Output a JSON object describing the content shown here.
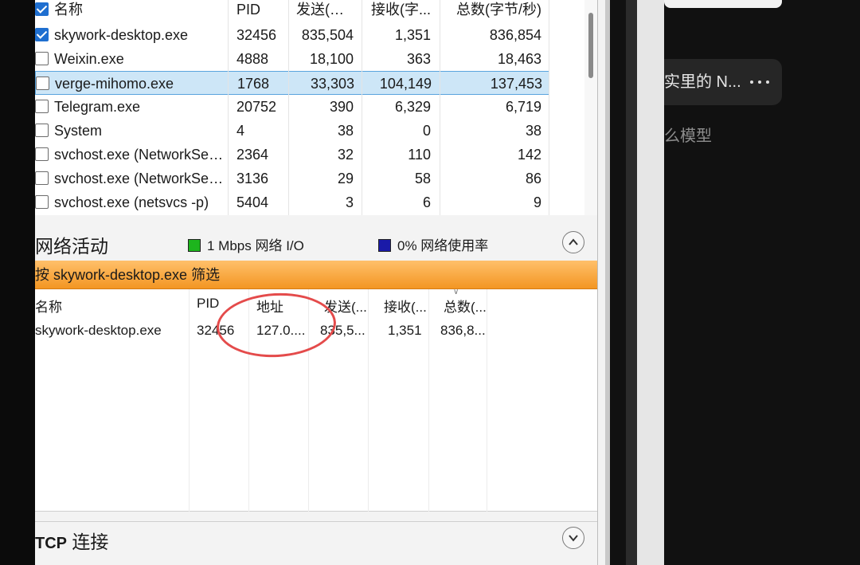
{
  "process_table": {
    "headers": [
      "名称",
      "PID",
      "发送(字...",
      "接收(字...",
      "总数(字节/秒)"
    ],
    "rows": [
      {
        "checked": true,
        "name": "skywork-desktop.exe",
        "pid": "32456",
        "send": "835,504",
        "recv": "1,351",
        "total": "836,854"
      },
      {
        "checked": false,
        "name": "Weixin.exe",
        "pid": "4888",
        "send": "18,100",
        "recv": "363",
        "total": "18,463"
      },
      {
        "checked": false,
        "name": "verge-mihomo.exe",
        "pid": "1768",
        "send": "33,303",
        "recv": "104,149",
        "total": "137,453",
        "selected": true
      },
      {
        "checked": false,
        "name": "Telegram.exe",
        "pid": "20752",
        "send": "390",
        "recv": "6,329",
        "total": "6,719"
      },
      {
        "checked": false,
        "name": "System",
        "pid": "4",
        "send": "38",
        "recv": "0",
        "total": "38"
      },
      {
        "checked": false,
        "name": "svchost.exe (NetworkServi...",
        "pid": "2364",
        "send": "32",
        "recv": "110",
        "total": "142"
      },
      {
        "checked": false,
        "name": "svchost.exe (NetworkServi...",
        "pid": "3136",
        "send": "29",
        "recv": "58",
        "total": "86"
      },
      {
        "checked": false,
        "name": "svchost.exe (netsvcs -p)",
        "pid": "5404",
        "send": "3",
        "recv": "6",
        "total": "9"
      }
    ]
  },
  "network_activity": {
    "title": "网络活动",
    "legend_io": "1 Mbps 网络 I/O",
    "legend_usage": "0% 网络使用率",
    "io_color": "#1db51d",
    "usage_color": "#1a1aa8",
    "filter_label": "按 skywork-desktop.exe 筛选",
    "filter_color": "#f7a53a",
    "headers": [
      "名称",
      "PID",
      "地址",
      "发送(...",
      "接收(...",
      "总数(..."
    ],
    "rows": [
      {
        "name": "skywork-desktop.exe",
        "pid": "32456",
        "address": "127.0....",
        "send": "835,5...",
        "recv": "1,351",
        "total": "836,8..."
      }
    ]
  },
  "tcp_section": {
    "prefix": "TCP",
    "title": "连接"
  },
  "right_app": {
    "chat_title": "实里的 N...",
    "more_icon": "more-horizontal-icon",
    "sub_text": "么模型"
  }
}
